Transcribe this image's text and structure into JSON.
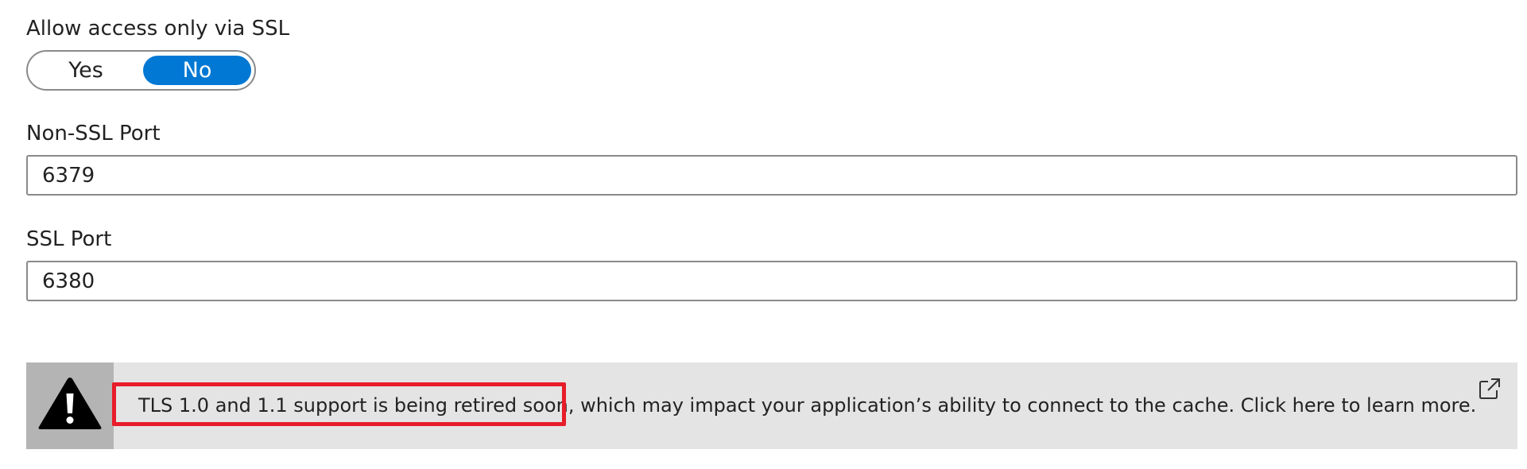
{
  "ssl_only": {
    "label": "Allow access only via SSL",
    "options": {
      "yes": "Yes",
      "no": "No"
    },
    "selected": "No"
  },
  "non_ssl_port": {
    "label": "Non-SSL Port",
    "value": "6379"
  },
  "ssl_port": {
    "label": "SSL Port",
    "value": "6380"
  },
  "tls_notice": {
    "icon": "warning-icon",
    "text": "TLS 1.0 and 1.1 support is being retired soon, which may impact your application’s ability to connect to the cache. Click here to learn more.",
    "link_icon": "external-link-icon"
  },
  "colors": {
    "accent": "#0078d4",
    "banner_background": "#e4e4e4",
    "icon_background": "#b4b4b4",
    "highlight": "#e81c2a"
  }
}
